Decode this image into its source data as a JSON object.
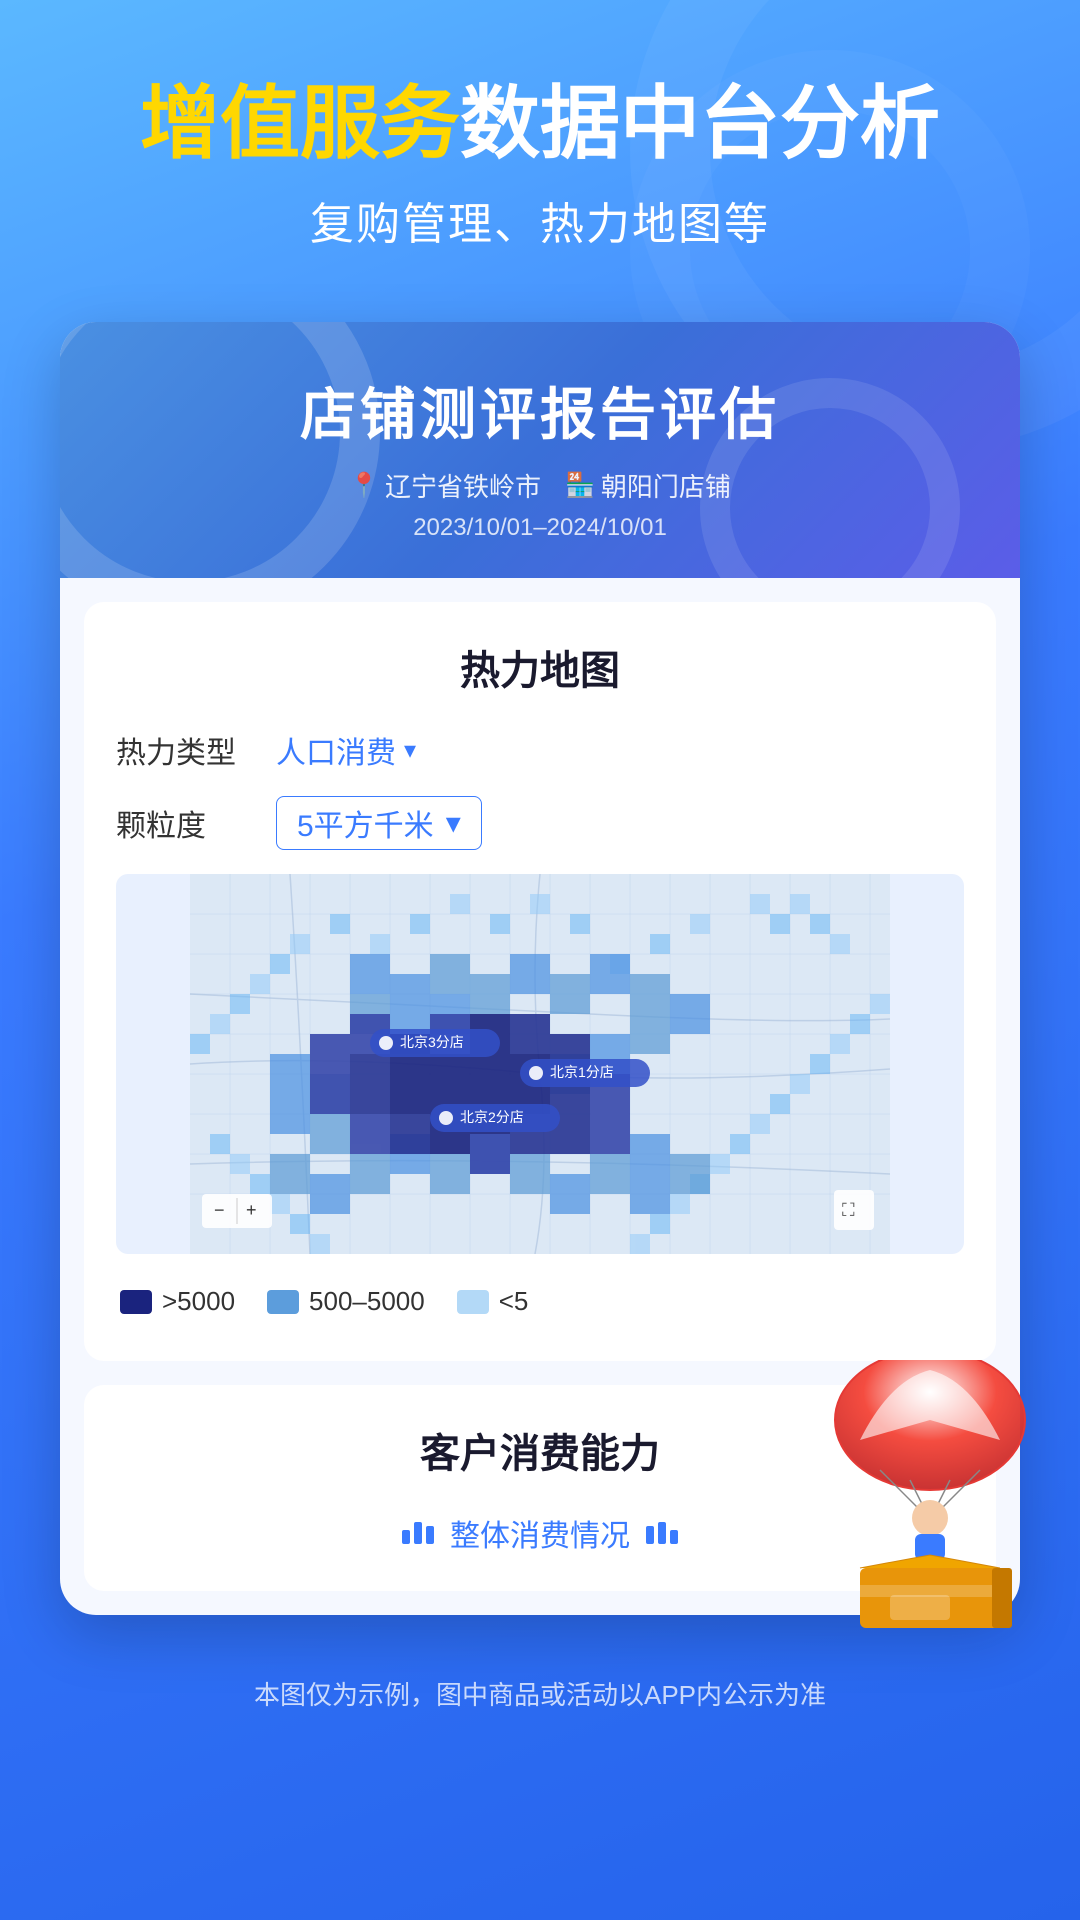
{
  "hero": {
    "title_yellow": "增值服务",
    "title_white": "数据中台分析",
    "subtitle": "复购管理、热力地图等"
  },
  "card": {
    "header": {
      "title": "店铺测评报告评估",
      "location": "辽宁省铁岭市",
      "store": "朝阳门店铺",
      "date": "2023/10/01–2024/10/01"
    },
    "heatmap": {
      "section_title": "热力地图",
      "filter_type_label": "热力类型",
      "filter_type_value": "人口消费",
      "filter_granularity_label": "颗粒度",
      "filter_granularity_value": "5平方千米",
      "labels": [
        {
          "text": "北京3分店",
          "x": "27%",
          "y": "43%"
        },
        {
          "text": "北京1分店",
          "x": "50%",
          "y": "50%"
        },
        {
          "text": "北京2分店",
          "x": "38%",
          "y": "62%"
        }
      ],
      "legend": [
        {
          "label": ">5000",
          "color": "dark"
        },
        {
          "label": "500–5000",
          "color": "mid"
        },
        {
          "label": "<5",
          "color": "light"
        }
      ],
      "zoom_minus": "−",
      "zoom_plus": "+"
    },
    "customer": {
      "section_title": "客户消费能力",
      "overall_label": "整体消费情况"
    }
  },
  "footer": {
    "disclaimer": "本图仅为示例，图中商品或活动以APP内公示为准"
  }
}
